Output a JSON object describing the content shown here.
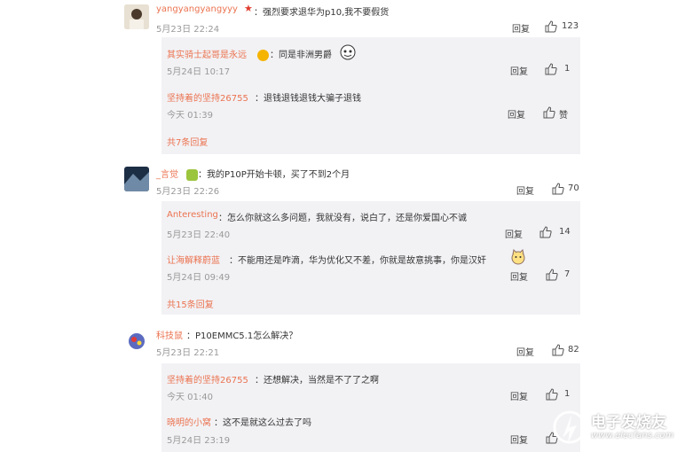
{
  "comments": [
    {
      "user": "yangyangyangyyy",
      "text": "强烈要求退华为p10,我不要假货",
      "time": "5月23日 22:24",
      "reply_label": "回复",
      "like_count": "123",
      "replies": [
        {
          "user": "其实骑士起哥是永远",
          "text": "同是非洲男爵",
          "time": "5月24日 10:17",
          "reply_label": "回复",
          "like_count": "1"
        },
        {
          "user": "坚持着的坚持26755",
          "text": "退钱退钱退钱大骗子退钱",
          "time": "今天 01:39",
          "reply_label": "回复",
          "like_count": "赞"
        }
      ],
      "more": "共7条回复"
    },
    {
      "user": "_言觉",
      "text": "我的P10P开始卡顿，买了不到2个月",
      "time": "5月23日 22:26",
      "reply_label": "回复",
      "like_count": "70",
      "replies": [
        {
          "user": "Anteresting",
          "text": "怎么你就这么多问题，我就没有，说白了，还是你爱国心不诚",
          "time": "5月23日 22:40",
          "reply_label": "回复",
          "like_count": "14"
        },
        {
          "user": "让海解释蔚蓝",
          "text": "不能用还是咋滴，华为优化又不差，你就是故意挑事，你是汉奸",
          "time": "5月24日 09:49",
          "reply_label": "回复",
          "like_count": "7"
        }
      ],
      "more": "共15条回复"
    },
    {
      "user": "科技鼠",
      "text": "P10EMMC5.1怎么解决？",
      "time": "5月23日 22:21",
      "reply_label": "回复",
      "like_count": "82",
      "replies": [
        {
          "user": "坚持着的坚持26755",
          "text": "还想解决，当然是不了了之啊",
          "time": "今天 01:40",
          "reply_label": "回复",
          "like_count": "1"
        },
        {
          "user": "晓明的小窝",
          "text": "这不是就这么过去了吗",
          "time": "5月24日 23:19",
          "reply_label": "回复",
          "like_count": ""
        }
      ]
    }
  ],
  "watermark": {
    "cn": "电子发烧友",
    "url": "www.elecfans.com"
  },
  "colors": {
    "username": "#eb7350",
    "reply_bg": "#f2f2f5",
    "time": "#999999"
  }
}
